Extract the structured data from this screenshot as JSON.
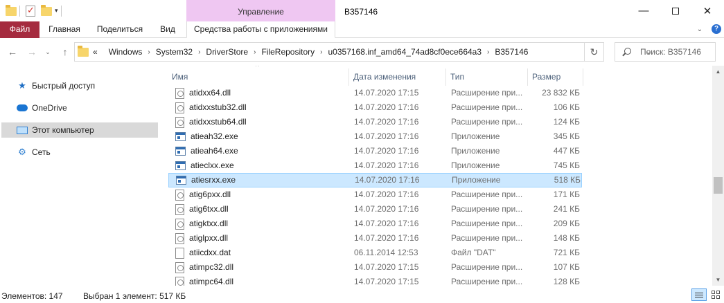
{
  "window": {
    "title": "B357146",
    "context_tab_group": "Управление",
    "minimize": "—",
    "close": "✕"
  },
  "ribbon": {
    "tabs": [
      "Файл",
      "Главная",
      "Поделиться",
      "Вид",
      "Средства работы с приложениями"
    ],
    "expand_icon": "chevron-down-icon",
    "help": "?"
  },
  "nav": {
    "back": "←",
    "forward": "→",
    "recent": "⌄",
    "up": "↑",
    "refresh": "↻"
  },
  "address": {
    "breadcrumb_prefix": "«",
    "crumbs": [
      "Windows",
      "System32",
      "DriverStore",
      "FileRepository",
      "u0357168.inf_amd64_74ad8cf0ece664a3",
      "B357146"
    ],
    "separator": "›"
  },
  "search": {
    "placeholder": "Поиск: B357146"
  },
  "sidebar": {
    "items": [
      {
        "label": "Быстрый доступ",
        "icon": "star-icon"
      },
      {
        "label": "OneDrive",
        "icon": "cloud-icon"
      },
      {
        "label": "Этот компьютер",
        "icon": "computer-icon",
        "selected": true
      },
      {
        "label": "Сеть",
        "icon": "network-icon"
      }
    ]
  },
  "columns": {
    "name": "Имя",
    "date": "Дата изменения",
    "type": "Тип",
    "size": "Размер",
    "sort_indicator": "^"
  },
  "files": [
    {
      "name": "atidxx64.dll",
      "date": "14.07.2020 17:15",
      "type": "Расширение при...",
      "size": "23 832 КБ",
      "kind": "dll"
    },
    {
      "name": "atidxxstub32.dll",
      "date": "14.07.2020 17:16",
      "type": "Расширение при...",
      "size": "106 КБ",
      "kind": "dll"
    },
    {
      "name": "atidxxstub64.dll",
      "date": "14.07.2020 17:16",
      "type": "Расширение при...",
      "size": "124 КБ",
      "kind": "dll"
    },
    {
      "name": "atieah32.exe",
      "date": "14.07.2020 17:16",
      "type": "Приложение",
      "size": "345 КБ",
      "kind": "exe"
    },
    {
      "name": "atieah64.exe",
      "date": "14.07.2020 17:16",
      "type": "Приложение",
      "size": "447 КБ",
      "kind": "exe"
    },
    {
      "name": "atieclxx.exe",
      "date": "14.07.2020 17:16",
      "type": "Приложение",
      "size": "745 КБ",
      "kind": "exe"
    },
    {
      "name": "atiesrxx.exe",
      "date": "14.07.2020 17:16",
      "type": "Приложение",
      "size": "518 КБ",
      "kind": "exe",
      "selected": true
    },
    {
      "name": "atig6pxx.dll",
      "date": "14.07.2020 17:16",
      "type": "Расширение при...",
      "size": "171 КБ",
      "kind": "dll"
    },
    {
      "name": "atig6txx.dll",
      "date": "14.07.2020 17:16",
      "type": "Расширение при...",
      "size": "241 КБ",
      "kind": "dll"
    },
    {
      "name": "atigktxx.dll",
      "date": "14.07.2020 17:16",
      "type": "Расширение при...",
      "size": "209 КБ",
      "kind": "dll"
    },
    {
      "name": "atiglpxx.dll",
      "date": "14.07.2020 17:16",
      "type": "Расширение при...",
      "size": "148 КБ",
      "kind": "dll"
    },
    {
      "name": "atiicdxx.dat",
      "date": "06.11.2014 12:53",
      "type": "Файл \"DAT\"",
      "size": "721 КБ",
      "kind": "dat"
    },
    {
      "name": "atimpc32.dll",
      "date": "14.07.2020 17:15",
      "type": "Расширение при...",
      "size": "107 КБ",
      "kind": "dll"
    },
    {
      "name": "atimpc64.dll",
      "date": "14.07.2020 17:15",
      "type": "Расширение при...",
      "size": "128 КБ",
      "kind": "dll"
    }
  ],
  "status": {
    "count": "Элементов: 147",
    "selection": "Выбран 1 элемент: 517 КБ"
  },
  "colors": {
    "file_tab": "#a52b3f",
    "context_tab": "#efc7f2",
    "selection": "#cce8ff",
    "header_text": "#4c607a"
  }
}
